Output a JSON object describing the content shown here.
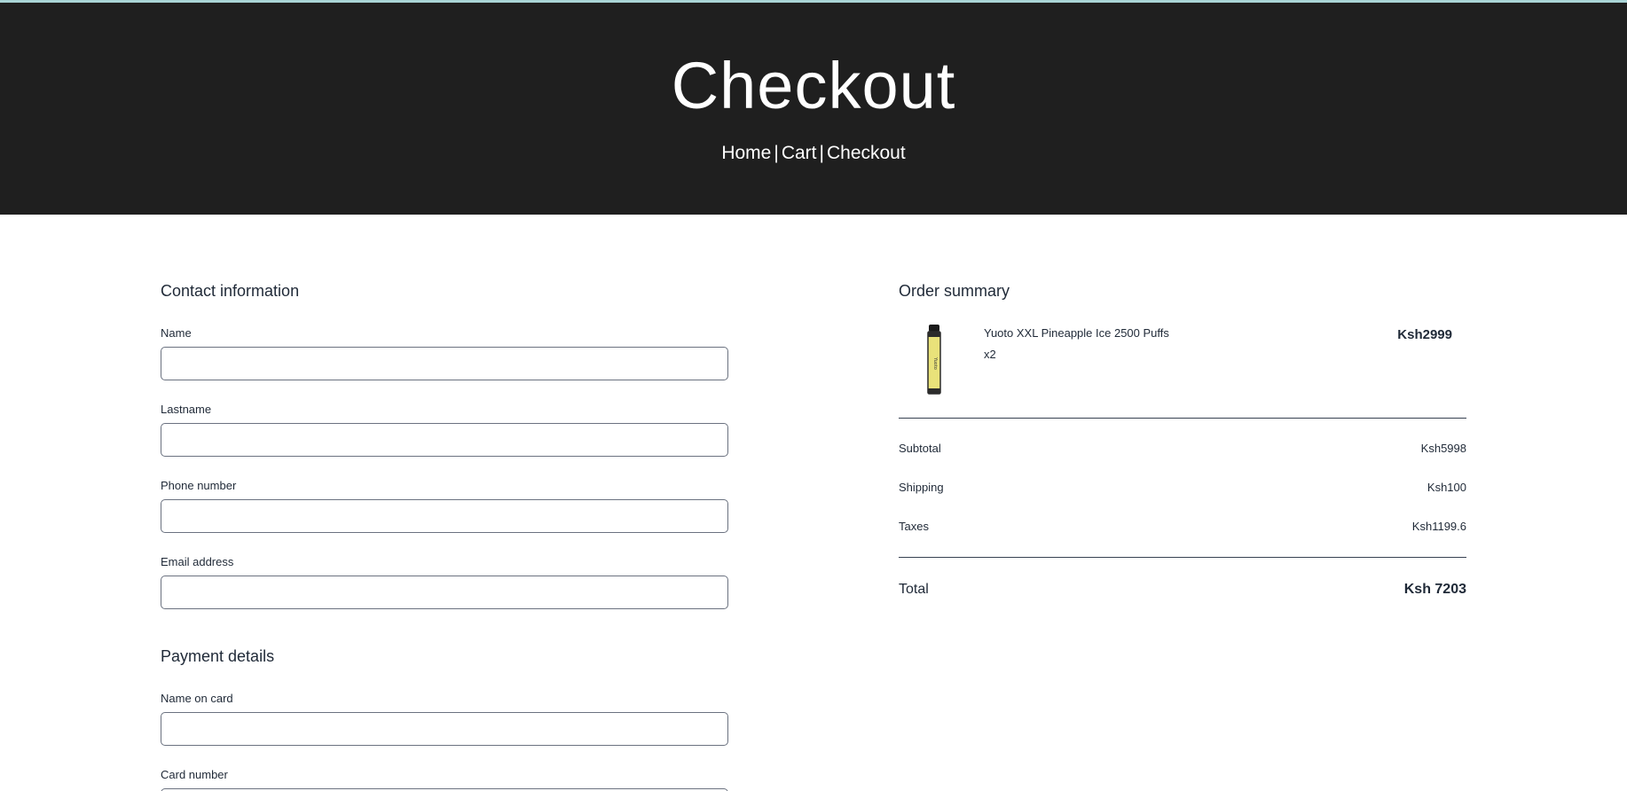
{
  "hero": {
    "title": "Checkout",
    "breadcrumb": {
      "home": "Home",
      "cart": "Cart",
      "checkout": "Checkout",
      "separator": "|"
    }
  },
  "contact": {
    "title": "Contact information",
    "fields": {
      "name": {
        "label": "Name",
        "value": ""
      },
      "lastname": {
        "label": "Lastname",
        "value": ""
      },
      "phone": {
        "label": "Phone number",
        "value": ""
      },
      "email": {
        "label": "Email address",
        "value": ""
      }
    }
  },
  "payment": {
    "title": "Payment details",
    "fields": {
      "name_on_card": {
        "label": "Name on card",
        "value": ""
      },
      "card_number": {
        "label": "Card number",
        "value": ""
      }
    }
  },
  "summary": {
    "title": "Order summary",
    "product": {
      "name": "Yuoto XXL Pineapple Ice 2500 Puffs",
      "quantity": "x2",
      "price": "Ksh2999",
      "image_icon": "vape-pen-icon"
    },
    "subtotal_label": "Subtotal",
    "subtotal_value": "Ksh5998",
    "shipping_label": "Shipping",
    "shipping_value": "Ksh100",
    "taxes_label": "Taxes",
    "taxes_value": "Ksh1199.6",
    "total_label": "Total",
    "total_value": "Ksh 7203"
  },
  "colors": {
    "hero_bg": "#1f1f1f",
    "top_accent": "#a9d4d6",
    "text": "#1f2937",
    "input_border": "#6b7280"
  }
}
